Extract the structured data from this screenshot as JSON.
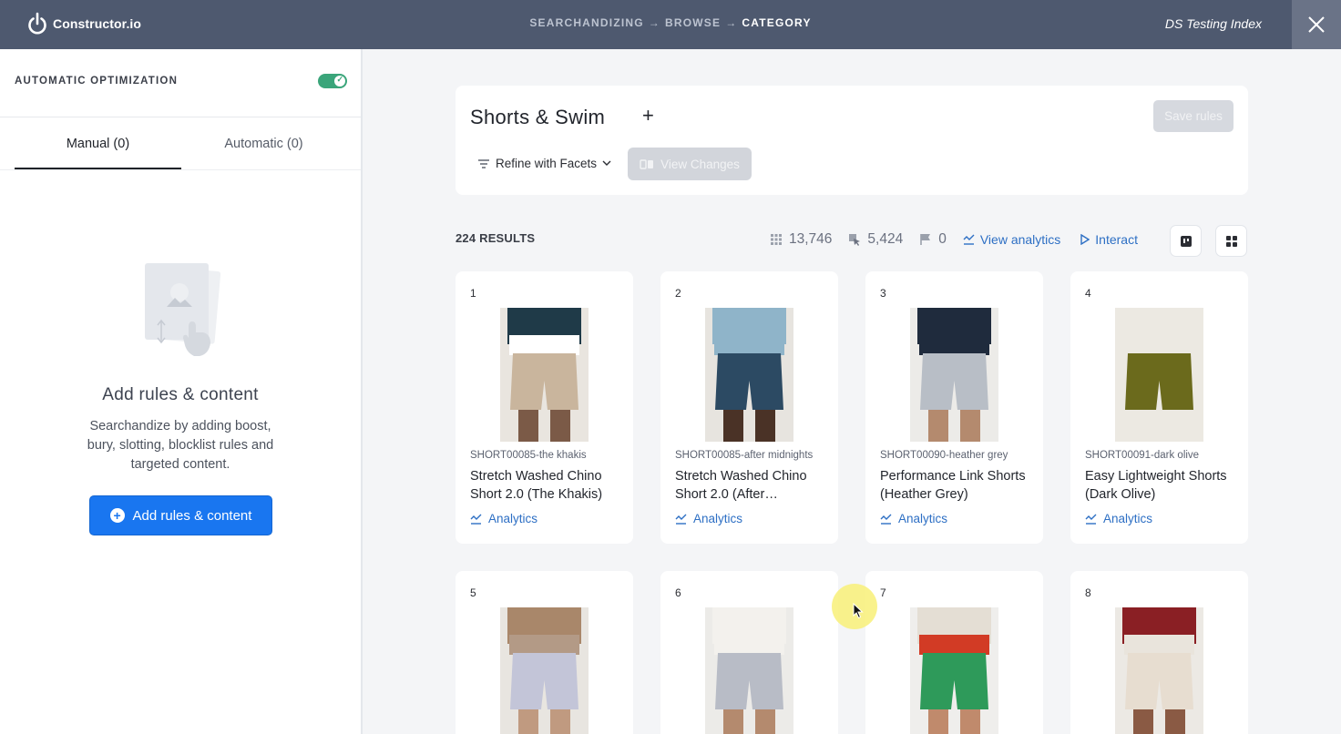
{
  "topbar": {
    "logo_text": "Constructor.io",
    "breadcrumbs": [
      {
        "label": "SEARCHANDIZING"
      },
      {
        "label": "BROWSE"
      },
      {
        "label": "CATEGORY"
      }
    ],
    "arrow": "→",
    "index_name": "DS Testing Index"
  },
  "left_panel": {
    "auto_opt_label": "AUTOMATIC OPTIMIZATION",
    "auto_opt_enabled": true,
    "tabs": [
      {
        "label": "Manual (0)",
        "active": true
      },
      {
        "label": "Automatic (0)",
        "active": false
      }
    ],
    "empty_title": "Add rules & content",
    "empty_desc": "Searchandize by adding boost, bury, slotting, blocklist rules and targeted content.",
    "add_button": "Add rules & content"
  },
  "header": {
    "title": "Shorts & Swim",
    "add_symbol": "+",
    "save_button": "Save rules",
    "refine_label": "Refine with Facets",
    "view_changes_label": "View Changes"
  },
  "results": {
    "count_label": "224 RESULTS",
    "stat_views": "13,746",
    "stat_clicks": "5,424",
    "stat_flags": "0",
    "view_analytics": "View analytics",
    "interact": "Interact"
  },
  "products": [
    {
      "rank": "1",
      "sku": "SHORT00085-the khakis",
      "name": "Stretch Washed Chino Short 2.0 (The Khakis)",
      "analytics": "Analytics",
      "colors": {
        "top": "#1f3a48",
        "mid": "#ffffff",
        "short": "#c9b59d",
        "leg": "#7b5a47",
        "bg": "#e9e5df"
      }
    },
    {
      "rank": "2",
      "sku": "SHORT00085-after midnights",
      "name": "Stretch Washed Chino Short 2.0 (After…",
      "analytics": "Analytics",
      "colors": {
        "top": "#8fb4c9",
        "mid": "#8fb4c9",
        "short": "#2c4a63",
        "leg": "#4a3226",
        "bg": "#e7e4df"
      }
    },
    {
      "rank": "3",
      "sku": "SHORT00090-heather grey",
      "name": "Performance Link Shorts (Heather Grey)",
      "analytics": "Analytics",
      "colors": {
        "top": "#1f2b3d",
        "mid": "#1f2b3d",
        "short": "#b8bec6",
        "leg": "#b48a6e",
        "bg": "#ecebe8"
      }
    },
    {
      "rank": "4",
      "sku": "SHORT00091-dark olive",
      "name": "Easy Lightweight Shorts (Dark Olive)",
      "analytics": "Analytics",
      "colors": {
        "top": "#ece9e2",
        "mid": "#ece9e2",
        "short": "#6b6a1c",
        "leg": "#ece9e2",
        "bg": "#ece9e2"
      }
    },
    {
      "rank": "5",
      "colors": {
        "top": "#a9876a",
        "mid": "#b39a86",
        "short": "#c3c5d8",
        "leg": "#c09a80",
        "bg": "#e8e5e0"
      }
    },
    {
      "rank": "6",
      "colors": {
        "top": "#f3f1ed",
        "mid": "#f3f1ed",
        "short": "#b8bcc6",
        "leg": "#b48a6e",
        "bg": "#ecebe8"
      }
    },
    {
      "rank": "7",
      "colors": {
        "top": "#e4ded4",
        "mid": "#d23b25",
        "short": "#2e9a5a",
        "leg": "#c08a6c",
        "bg": "#efeeec"
      }
    },
    {
      "rank": "8",
      "colors": {
        "top": "#8a1f24",
        "mid": "#e9e4dc",
        "short": "#e7ddd0",
        "leg": "#8a5a44",
        "bg": "#ece9e4"
      }
    }
  ]
}
